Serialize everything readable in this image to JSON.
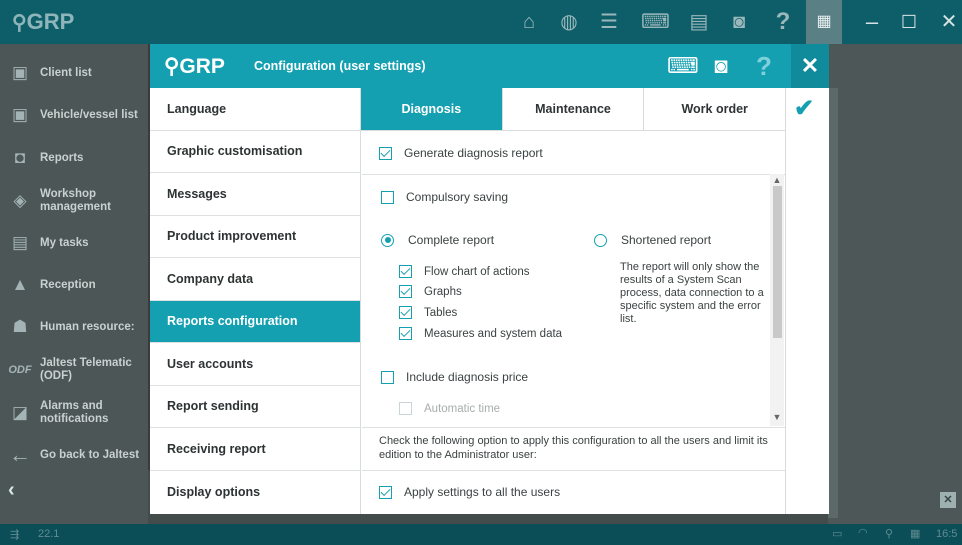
{
  "app": {
    "logo": "GRP",
    "top_icons": [
      "home-icon",
      "globe-icon",
      "list-icon",
      "keyboard-icon",
      "printer-icon",
      "camera-icon",
      "help-icon",
      "grid-icon",
      "minimize-icon",
      "maximize-icon",
      "close-icon"
    ],
    "sidebar": [
      {
        "label": "Client list",
        "icon": "client-list-icon"
      },
      {
        "label": "Vehicle/vessel list",
        "icon": "vehicle-list-icon"
      },
      {
        "label": "Reports",
        "icon": "reports-icon"
      },
      {
        "label": "Workshop management",
        "icon": "workshop-icon"
      },
      {
        "label": "My tasks",
        "icon": "tasks-icon"
      },
      {
        "label": "Reception",
        "icon": "reception-icon"
      },
      {
        "label": "Human resource:",
        "icon": "human-resources-icon"
      },
      {
        "label": "Jaltest Telematic (ODF)",
        "icon": "odf-icon"
      },
      {
        "label": "Alarms and notifications",
        "icon": "alarm-icon"
      },
      {
        "label": "Go back to Jaltest",
        "icon": "arrow-left-icon"
      }
    ],
    "status": {
      "version": "22.1",
      "clock": "16:5"
    }
  },
  "dialog": {
    "logo": "GRP",
    "title": "Configuration (user settings)",
    "menu": [
      {
        "label": "Language",
        "active": false
      },
      {
        "label": "Graphic customisation",
        "active": false
      },
      {
        "label": "Messages",
        "active": false
      },
      {
        "label": "Product improvement",
        "active": false
      },
      {
        "label": "Company data",
        "active": false
      },
      {
        "label": "Reports configuration",
        "active": true
      },
      {
        "label": "User accounts",
        "active": false
      },
      {
        "label": "Report sending",
        "active": false
      },
      {
        "label": "Receiving report",
        "active": false
      },
      {
        "label": "Display options",
        "active": false
      }
    ],
    "tabs": [
      {
        "label": "Diagnosis",
        "active": true
      },
      {
        "label": "Maintenance",
        "active": false
      },
      {
        "label": "Work order",
        "active": false
      }
    ],
    "generate_report": {
      "label": "Generate diagnosis report",
      "checked": true
    },
    "compulsory_saving": {
      "label": "Compulsory saving",
      "checked": false
    },
    "complete_report": {
      "label": "Complete report",
      "selected": true
    },
    "shortened_report": {
      "label": "Shortened report",
      "selected": false
    },
    "options": [
      {
        "label": "Flow chart of actions",
        "checked": true
      },
      {
        "label": "Graphs",
        "checked": true
      },
      {
        "label": "Tables",
        "checked": true
      },
      {
        "label": "Measures and system data",
        "checked": true
      }
    ],
    "shortened_note": "The report will only show the results of a System Scan process, data connection to a specific system and the error list.",
    "include_price": {
      "label": "Include diagnosis price",
      "checked": false
    },
    "automatic_time": {
      "label": "Automatic time",
      "checked": false,
      "disabled": true
    },
    "footnote": "Check the following option to apply this configuration to all the users and limit its edition to the Administrator user:",
    "apply_all": {
      "label": "Apply settings to all the users",
      "checked": true
    }
  }
}
